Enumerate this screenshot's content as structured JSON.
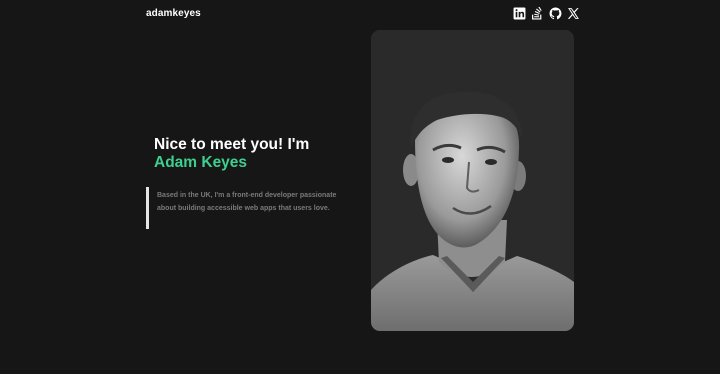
{
  "header": {
    "logo_text": "adamkeyes",
    "socials": [
      {
        "name": "linkedin",
        "icon": "linkedin-icon"
      },
      {
        "name": "stackoverflow",
        "icon": "stackoverflow-icon"
      },
      {
        "name": "github",
        "icon": "github-icon"
      },
      {
        "name": "x",
        "icon": "x-icon"
      }
    ]
  },
  "intro": {
    "greeting": "Nice to meet you! I'm",
    "name": "Adam Keyes",
    "bio": "Based in the UK, I'm a front-end developer passionate about building accessible web apps that users love."
  },
  "colors": {
    "background": "#161616",
    "accent": "#3ecf8e",
    "bio_text": "#7a7a7a",
    "card": "#2a2a2a"
  }
}
